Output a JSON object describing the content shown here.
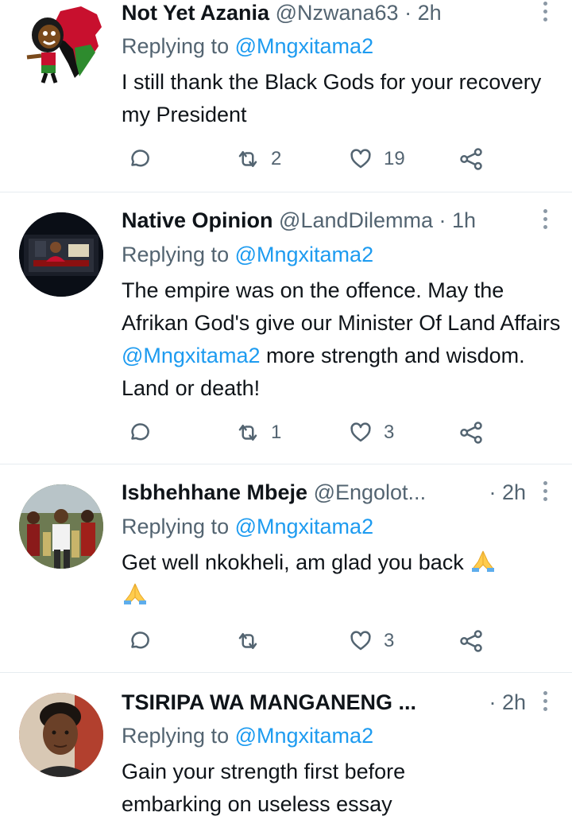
{
  "tweets": [
    {
      "display_name": "Not Yet Azania",
      "handle": "@Nzwana63",
      "time": "· 2h",
      "replying_prefix": "Replying to",
      "replying_to": "@Mngxitama2",
      "text_parts": [
        "I still thank the Black Gods for your recovery my President"
      ],
      "counts": {
        "reply": "",
        "retweet": "2",
        "like": "19"
      },
      "avatar": "avatar-cartoon-africa-map-icon"
    },
    {
      "display_name": "Native Opinion",
      "handle": "@LandDilemma",
      "time": "· 1h",
      "replying_prefix": "Replying to",
      "replying_to": "@Mngxitama2",
      "text_before": "The empire was on the offence. May the Afrikan God's give our Minister Of Land Affairs",
      "text_mention": "@Mngxitama2",
      "text_after": "more strength and wisdom. Land or death!",
      "counts": {
        "reply": "",
        "retweet": "1",
        "like": "3"
      },
      "avatar": "avatar-speaker-on-screen-icon"
    },
    {
      "display_name": "Isbhehhane Mbeje",
      "handle": "@Engolot...",
      "time": "· 2h",
      "replying_prefix": "Replying to",
      "replying_to": "@Mngxitama2",
      "text": "Get well nkokheli, am glad you back",
      "emoji": "folded-hands-emoji",
      "counts": {
        "reply": "",
        "retweet": "",
        "like": "3"
      },
      "avatar": "avatar-crowd-photo-icon"
    },
    {
      "display_name": "TSIRIPA WA MANGANENG ...",
      "handle": "",
      "time": "· 2h",
      "replying_prefix": "Replying to",
      "replying_to": "@Mngxitama2",
      "text": "Gain your strength first before embarking on useless essay",
      "avatar": "avatar-portrait-photo-icon"
    }
  ],
  "colors": {
    "text": "#0f1419",
    "secondary": "#536471",
    "link": "#1d9bf0",
    "divider": "#e6ecf0"
  }
}
